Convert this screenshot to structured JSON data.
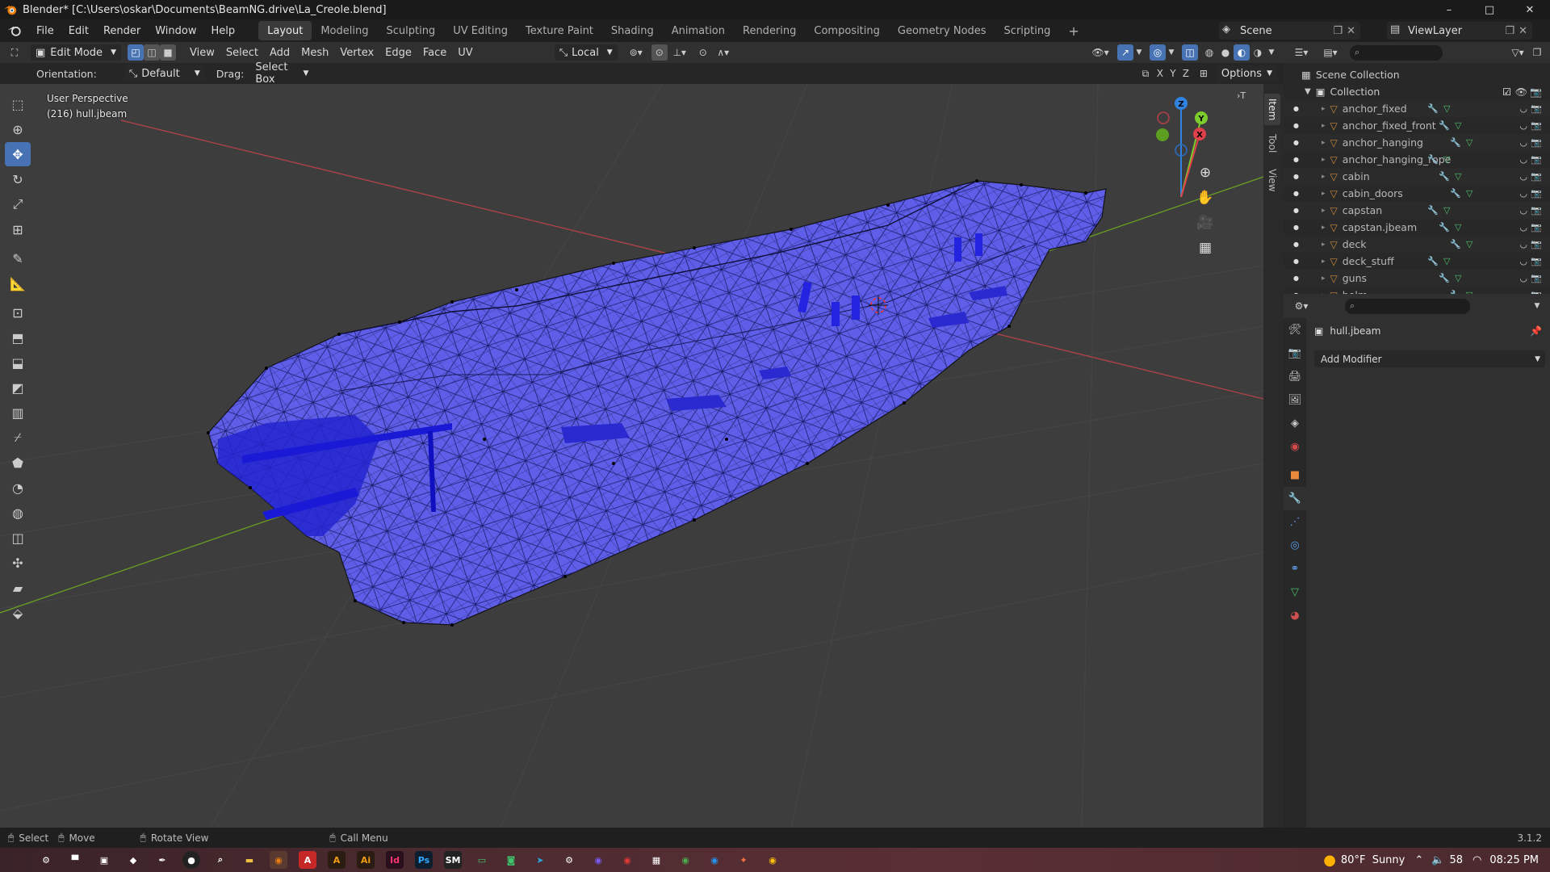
{
  "window": {
    "title": "Blender* [C:\\Users\\oskar\\Documents\\BeamNG.drive\\La_Creole.blend]",
    "minimize": "–",
    "maximize": "□",
    "close": "✕"
  },
  "menus": [
    "File",
    "Edit",
    "Render",
    "Window",
    "Help"
  ],
  "workspaces": [
    "Layout",
    "Modeling",
    "Sculpting",
    "UV Editing",
    "Texture Paint",
    "Shading",
    "Animation",
    "Rendering",
    "Compositing",
    "Geometry Nodes",
    "Scripting"
  ],
  "active_workspace": "Layout",
  "scene": {
    "name": "Scene",
    "view_layer": "ViewLayer"
  },
  "header": {
    "mode": "Edit Mode",
    "menus": [
      "View",
      "Select",
      "Add",
      "Mesh",
      "Vertex",
      "Edge",
      "Face",
      "UV"
    ],
    "transform_orientation": "Local"
  },
  "tool_settings": {
    "orientation_label": "Orientation:",
    "orientation_value": "Default",
    "drag_label": "Drag:",
    "drag_value": "Select Box",
    "axes": [
      "X",
      "Y",
      "Z"
    ],
    "options": "Options"
  },
  "viewport": {
    "view_name": "User Perspective",
    "object_info": "(216) hull.jbeam",
    "side_tabs": [
      "Item",
      "Tool",
      "View"
    ],
    "gizmo_axes": [
      "Z",
      "Y",
      "X"
    ]
  },
  "outliner": {
    "root": "Scene Collection",
    "collection": "Collection",
    "items": [
      "anchor_fixed",
      "anchor_fixed_front",
      "anchor_hanging",
      "anchor_hanging_rope",
      "cabin",
      "cabin_doors",
      "capstan",
      "capstan.jbeam",
      "deck",
      "deck_stuff",
      "guns",
      "helm"
    ]
  },
  "properties": {
    "object_name": "hull.jbeam",
    "add_modifier": "Add Modifier"
  },
  "statusbar": {
    "select": "Select",
    "move": "Move",
    "rotate_view": "Rotate View",
    "call_menu": "Call Menu",
    "version": "3.1.2"
  },
  "taskbar": {
    "weather": "80°F  Sunny",
    "volume": "58",
    "time": "08:25 PM"
  },
  "colors": {
    "mesh_fill": "#5c5ce6",
    "selection": "#4772b3",
    "axis_x": "#e0404a",
    "axis_y": "#7ccc2c",
    "axis_z": "#2f83e0"
  }
}
